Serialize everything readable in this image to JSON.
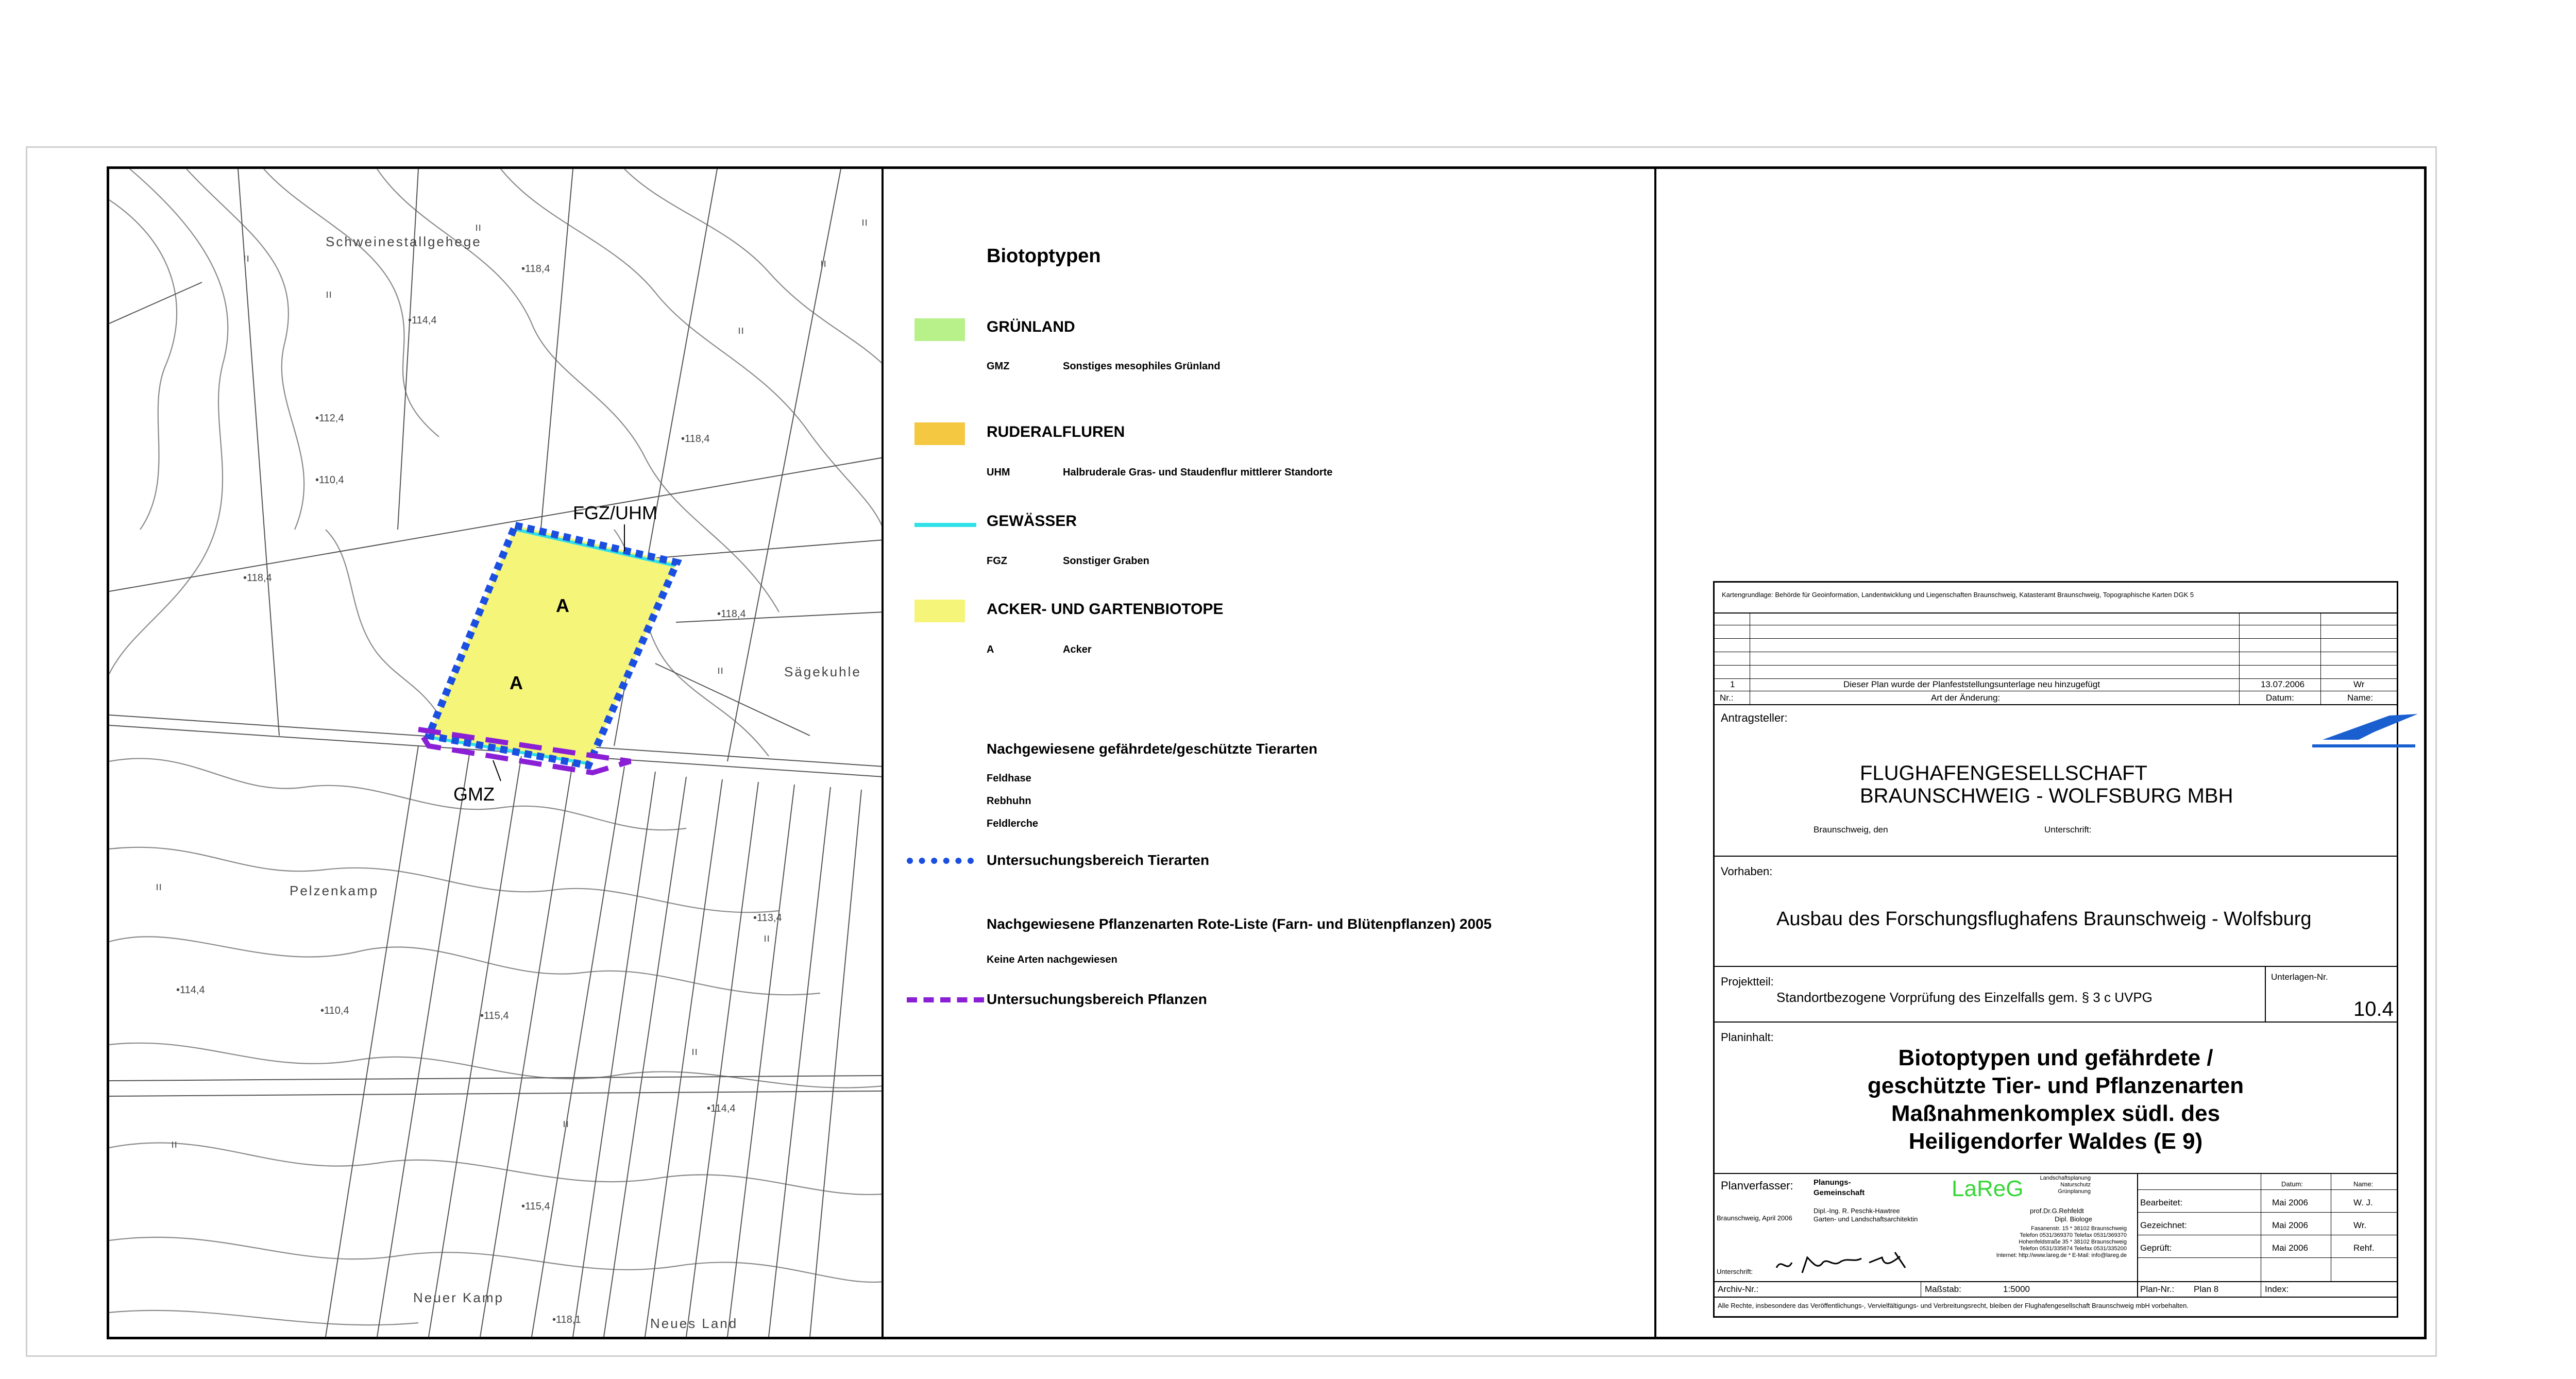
{
  "map": {
    "place_labels": [
      "Schweinestallgehege",
      "Sägekuhle",
      "Pelzenkamp",
      "Neuer Kamp",
      "Neues Land"
    ],
    "area_labels": [
      "A",
      "A"
    ],
    "zone_labels": [
      "FGZ/UHM",
      "GMZ"
    ],
    "elevations": [
      "118,4",
      "114,4",
      "112,4",
      "118,4",
      "110,4",
      "118,4",
      "118,4",
      "113,4",
      "114,4",
      "115,4",
      "114,4",
      "110,4",
      "115,4",
      "118,1"
    ],
    "colors": {
      "acker": "#f5f57a",
      "gewaesser": "#2fe0e8",
      "tierarten": "#1a4fe0",
      "pflanzen": "#8a1fd6"
    }
  },
  "legend": {
    "title": "Biotoptypen",
    "groups": [
      {
        "head": "GRÜNLAND",
        "color": "#b8f08a",
        "code": "GMZ",
        "desc": "Sonstiges mesophiles Grünland",
        "kind": "fill"
      },
      {
        "head": "RUDERALFLUREN",
        "color": "#f5c842",
        "code": "UHM",
        "desc": "Halbruderale Gras- und Staudenflur mittlerer Standorte",
        "kind": "fill"
      },
      {
        "head": "GEWÄSSER",
        "color": "#2fe0e8",
        "code": "FGZ",
        "desc": "Sonstiger Graben",
        "kind": "line"
      },
      {
        "head": "ACKER- UND GARTENBIOTOPE",
        "color": "#f5f57a",
        "code": "A",
        "desc": "Acker",
        "kind": "fill"
      }
    ],
    "fauna_head": "Nachgewiesene gefährdete/geschützte Tierarten",
    "fauna": [
      "Feldhase",
      "Rebhuhn",
      "Feldlerche"
    ],
    "fauna_area": "Untersuchungsbereich Tierarten",
    "flora_head": "Nachgewiesene Pflanzenarten Rote-Liste (Farn- und Blütenpflanzen) 2005",
    "flora_note": "Keine Arten nachgewiesen",
    "flora_area": "Untersuchungsbereich Pflanzen"
  },
  "titleblock": {
    "basis": "Kartengrundlage: Behörde für Geoinformation, Landentwicklung und Liegenschaften Braunschweig, Katasteramt Braunschweig, Topographische Karten  DGK 5",
    "rev_no": "1",
    "rev_text": "Dieser Plan wurde der Planfeststellungsunterlage neu hinzugefügt",
    "rev_date": "13.07.2006",
    "rev_name": "Wr",
    "col_nr": "Nr.:",
    "col_art": "Art der Änderung:",
    "col_datum": "Datum:",
    "col_name": "Name:",
    "antragsteller_label": "Antragsteller:",
    "company1": "FLUGHAFENGESELLSCHAFT",
    "company2": "BRAUNSCHWEIG - WOLFSBURG MBH",
    "place_date": "Braunschweig, den",
    "signature_label": "Unterschrift:",
    "vorhaben_label": "Vorhaben:",
    "vorhaben": "Ausbau des Forschungsflughafens Braunschweig - Wolfsburg",
    "projektteil_label": "Projektteil:",
    "projektteil": "Standortbezogene Vorprüfung des Einzelfalls gem. § 3 c UVPG",
    "unterlagen_label": "Unterlagen-Nr.",
    "unterlagen": "10.4",
    "planinhalt_label": "Planinhalt:",
    "planinhalt": [
      "Biotoptypen und gefährdete /",
      "geschützte Tier- und Pflanzenarten",
      "Maßnahmenkomplex südl. des",
      "Heiligendorfer Waldes (E 9)"
    ],
    "planverfasser_label": "Planverfasser:",
    "pg1": "Planungs-",
    "pg2": "Gemeinschaft",
    "lareg": "LaReG",
    "lareg_right": [
      "Landschaftsplanung",
      "Naturschutz",
      "Grünplanung"
    ],
    "partner1": "Dipl.-Ing. R. Peschk-Hawtree",
    "partner1b": "Garten- und Landschaftsarchitektin",
    "partner2": "prof.Dr.G.Rehfeldt",
    "partner2b": "Dipl. Biologe",
    "address": [
      "Fasanenstr. 15 * 38102 Braunschweig",
      "Telefon 0531/369370  Telefax 0531/369370",
      "Hohenfeldstraße 35 * 38102 Braunschweig",
      "Telefon 0531/335874  Telefax 0531/335200",
      "Internet: http://www.lareg.de * E-Mail: info@lareg.de"
    ],
    "place_date2": "Braunschweig, April 2006",
    "signature2_label": "Unterschrift:",
    "bearbeitet_label": "Bearbeitet:",
    "bearbeitet_date": "Mai 2006",
    "bearbeitet_name": "W. J.",
    "gezeichnet_label": "Gezeichnet:",
    "gezeichnet_date": "Mai 2006",
    "gezeichnet_name": "Wr.",
    "geprueft_label": "Geprüft:",
    "geprueft_date": "Mai 2006",
    "geprueft_name": "Rehf.",
    "datum_col": "Datum:",
    "name_col": "Name:",
    "archiv_label": "Archiv-Nr.:",
    "massstab_label": "Maßstab:",
    "massstab": "1:5000",
    "plannr_label": "Plan-Nr.:",
    "plannr": "Plan  8",
    "index_label": "Index:",
    "rights": "Alle Rechte, insbesondere das Veröffentlichungs-, Vervielfältigungs- und Verbreitungsrecht, bleiben der Flughafengesellschaft Braunschweig mbH vorbehalten."
  }
}
